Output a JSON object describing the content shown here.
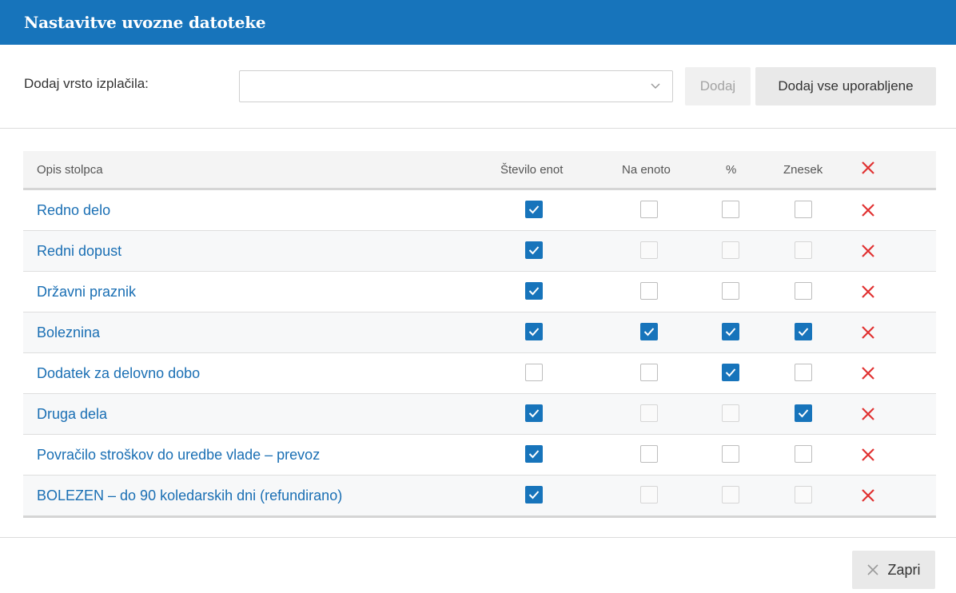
{
  "dialog": {
    "title": "Nastavitve uvozne datoteke"
  },
  "toolbar": {
    "label": "Dodaj vrsto izplačila:",
    "select_value": "",
    "add_label": "Dodaj",
    "add_all_label": "Dodaj vse uporabljene"
  },
  "table": {
    "headers": {
      "description": "Opis stolpca",
      "units": "Število enot",
      "per_unit": "Na enoto",
      "percent": "%",
      "amount": "Znesek"
    },
    "rows": [
      {
        "name": "Redno delo",
        "units": true,
        "per_unit": false,
        "percent": false,
        "amount": false
      },
      {
        "name": "Redni dopust",
        "units": true,
        "per_unit": false,
        "percent": false,
        "amount": false
      },
      {
        "name": "Državni praznik",
        "units": true,
        "per_unit": false,
        "percent": false,
        "amount": false
      },
      {
        "name": "Boleznina",
        "units": true,
        "per_unit": true,
        "percent": true,
        "amount": true
      },
      {
        "name": "Dodatek za delovno dobo",
        "units": false,
        "per_unit": false,
        "percent": true,
        "amount": false
      },
      {
        "name": "Druga dela",
        "units": true,
        "per_unit": false,
        "percent": false,
        "amount": true
      },
      {
        "name": "Povračilo stroškov do uredbe vlade – prevoz",
        "units": true,
        "per_unit": false,
        "percent": false,
        "amount": false
      },
      {
        "name": "BOLEZEN – do 90 koledarskih dni (refundirano)",
        "units": true,
        "per_unit": false,
        "percent": false,
        "amount": false
      }
    ]
  },
  "footer": {
    "close_label": "Zapri"
  },
  "colors": {
    "accent": "#1774bb",
    "link": "#1a6fb4",
    "delete": "#e03131"
  },
  "icons": {
    "select": "chevron-down-icon",
    "delete": "close-icon",
    "checked": "check-icon"
  }
}
